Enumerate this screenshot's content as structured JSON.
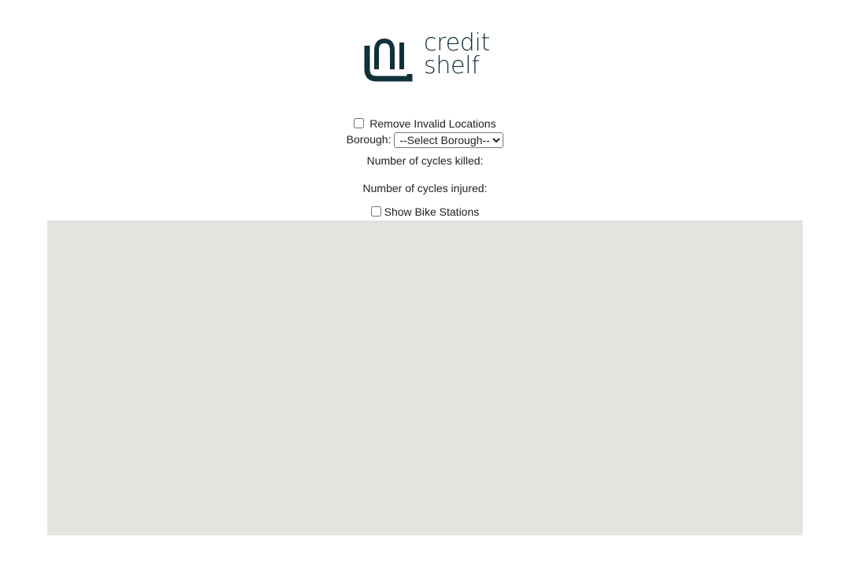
{
  "logo": {
    "name": "credit shelf logo",
    "line1": "credit",
    "line2": "shelf",
    "color": "#10303a"
  },
  "filters": {
    "remove_invalid_label": "Remove Invalid Locations",
    "remove_invalid_checked": false,
    "borough_label": "Borough:",
    "borough_selected": "--Select Borough--",
    "borough_options": [
      "--Select Borough--"
    ]
  },
  "stats": {
    "killed_label": "Number of cycles killed:",
    "killed_value": "",
    "injured_label": "Number of cycles injured:",
    "injured_value": ""
  },
  "bike_stations": {
    "label": "Show Bike Stations",
    "checked": false
  },
  "map": {
    "background": "#e5e3df"
  }
}
